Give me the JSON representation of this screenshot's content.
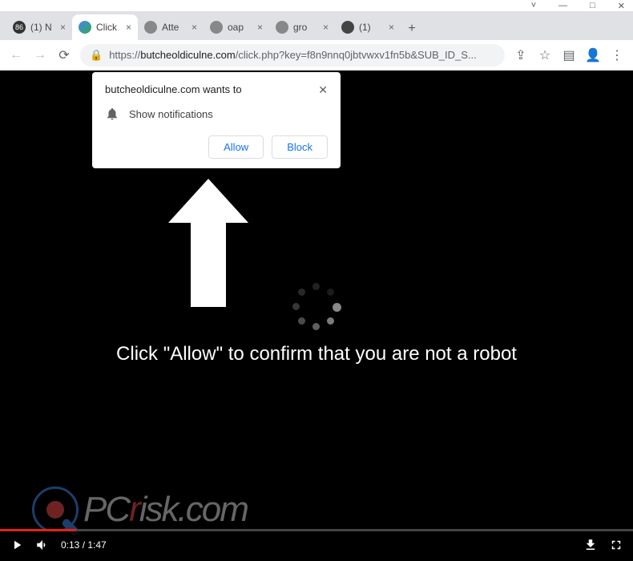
{
  "window_controls": {
    "min": "—",
    "max": "□",
    "close": "✕",
    "drop": "˅"
  },
  "tabs": [
    {
      "label": "(1) N",
      "fav": "86"
    },
    {
      "label": "Click",
      "fav": "chrome"
    },
    {
      "label": "Atte",
      "fav": "globe"
    },
    {
      "label": "oap",
      "fav": "globe"
    },
    {
      "label": "gro",
      "fav": "globe"
    },
    {
      "label": "(1)",
      "fav": "print"
    }
  ],
  "newtab": "+",
  "address": {
    "scheme": "https://",
    "host": "butcheoldiculne.com",
    "path": "/click.php?key=f8n9nnq0jbtvwxv1fn5b&SUB_ID_S..."
  },
  "permission": {
    "title": "butcheoldiculne.com wants to",
    "line": "Show notifications",
    "allow": "Allow",
    "block": "Block"
  },
  "page": {
    "text": "Click \"Allow\" to confirm that you are not a robot"
  },
  "video": {
    "time": "0:13 / 1:47"
  },
  "watermark": {
    "p": "PC",
    "r": "r",
    "rest": "isk.com"
  }
}
